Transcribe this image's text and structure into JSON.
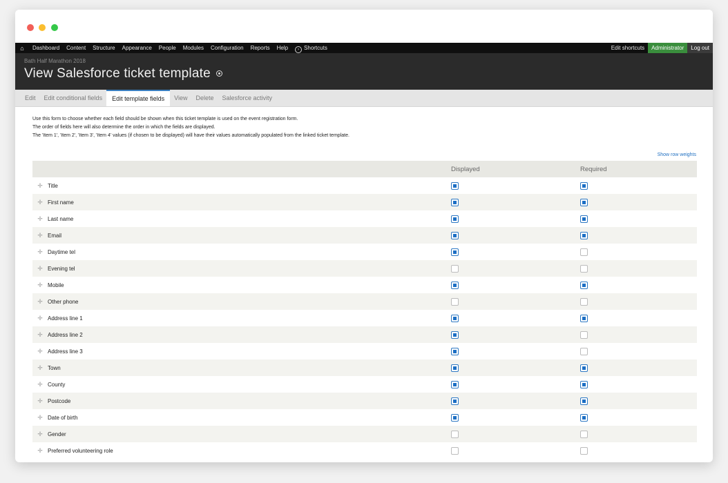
{
  "toolbar": {
    "items": [
      "Dashboard",
      "Content",
      "Structure",
      "Appearance",
      "People",
      "Modules",
      "Configuration",
      "Reports",
      "Help"
    ],
    "shortcuts_label": "Shortcuts",
    "edit_shortcuts": "Edit shortcuts",
    "user": "Administrator",
    "logout": "Log out"
  },
  "header": {
    "site_name": "Bath Half Marathon 2018",
    "title": "View Salesforce ticket template"
  },
  "tabs": [
    "Edit",
    "Edit conditional fields",
    "Edit template fields",
    "View",
    "Delete",
    "Salesforce activity"
  ],
  "active_tab": "Edit template fields",
  "help": [
    "Use this form to choose whether each field should be shown when this ticket template is used on the event registration form.",
    "The order of fields here will also determine the order in which the fields are displayed.",
    "The 'Item 1', 'Item 2', 'Item 3', 'Item 4' values (if chosen to be displayed) will have their values automatically populated from the linked ticket template."
  ],
  "show_row_weights": "Show row weights",
  "table": {
    "headers": [
      "",
      "Displayed",
      "Required"
    ],
    "rows": [
      {
        "name": "Title",
        "displayed": true,
        "required": true
      },
      {
        "name": "First name",
        "displayed": true,
        "required": true
      },
      {
        "name": "Last name",
        "displayed": true,
        "required": true
      },
      {
        "name": "Email",
        "displayed": true,
        "required": true
      },
      {
        "name": "Daytime tel",
        "displayed": true,
        "required": false
      },
      {
        "name": "Evening tel",
        "displayed": false,
        "required": false
      },
      {
        "name": "Mobile",
        "displayed": true,
        "required": true
      },
      {
        "name": "Other phone",
        "displayed": false,
        "required": false
      },
      {
        "name": "Address line 1",
        "displayed": true,
        "required": true
      },
      {
        "name": "Address line 2",
        "displayed": true,
        "required": false
      },
      {
        "name": "Address line 3",
        "displayed": true,
        "required": false
      },
      {
        "name": "Town",
        "displayed": true,
        "required": true
      },
      {
        "name": "County",
        "displayed": true,
        "required": true
      },
      {
        "name": "Postcode",
        "displayed": true,
        "required": true
      },
      {
        "name": "Date of birth",
        "displayed": true,
        "required": true
      },
      {
        "name": "Gender",
        "displayed": false,
        "required": false
      },
      {
        "name": "Preferred volunteering role",
        "displayed": false,
        "required": false
      }
    ]
  }
}
